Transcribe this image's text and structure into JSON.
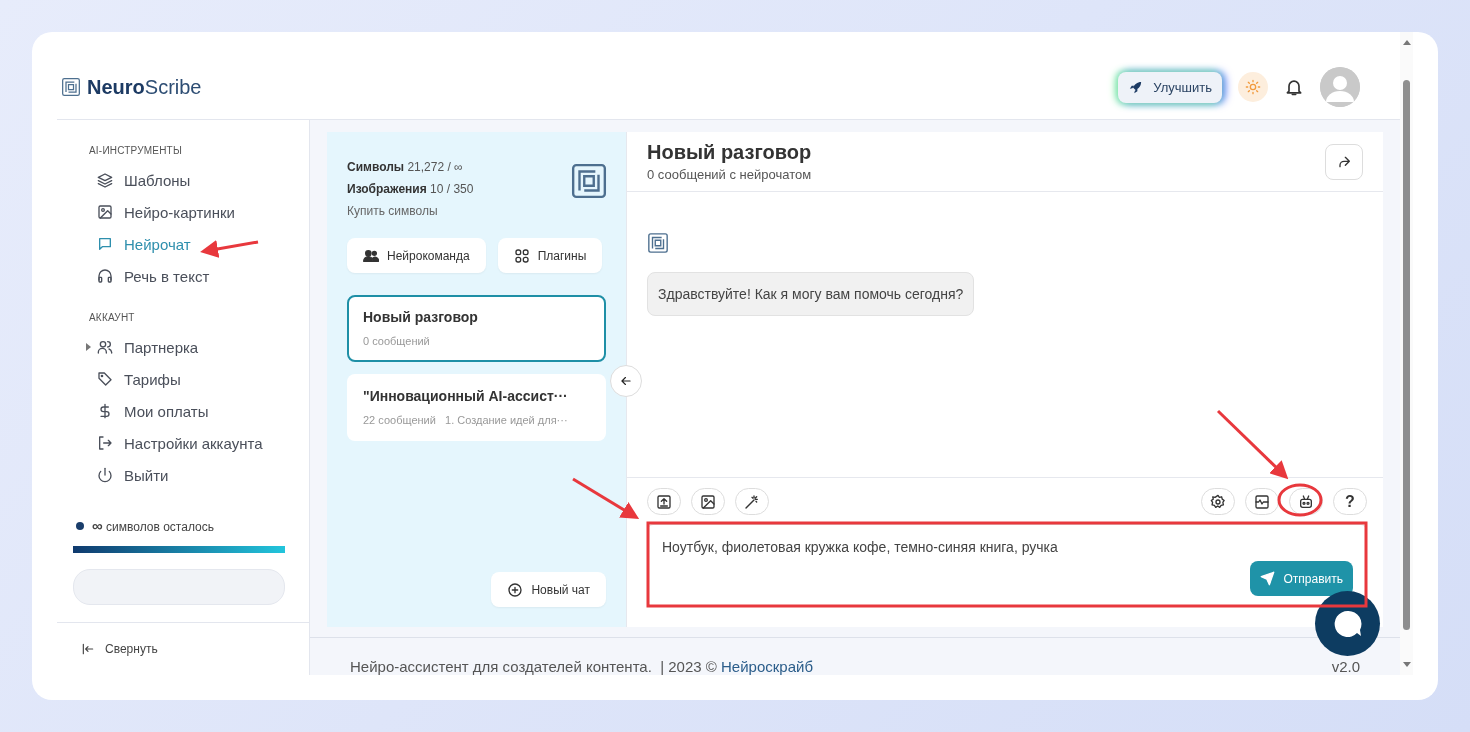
{
  "brand": {
    "name": "**Neuro**Scribe"
  },
  "header": {
    "upgrade_button": "Улучшить"
  },
  "sidebar": {
    "sections": [
      {
        "title": "AI-ИНСТРУМЕНТЫ",
        "items": [
          {
            "label": "Шаблоны",
            "kind": "layers",
            "selected": false,
            "expandable": false
          },
          {
            "label": "Нейро-картинки",
            "kind": "image",
            "selected": false,
            "expandable": false
          },
          {
            "label": "Нейрочат",
            "kind": "chat",
            "selected": true,
            "expandable": false
          },
          {
            "label": "Речь в текст",
            "kind": "headphones",
            "selected": false,
            "expandable": false
          }
        ]
      },
      {
        "title": "АККАУНТ",
        "items": [
          {
            "label": "Партнерка",
            "kind": "users",
            "selected": false,
            "expandable": true
          },
          {
            "label": "Тарифы",
            "kind": "tag",
            "selected": false,
            "expandable": false
          },
          {
            "label": "Мои оплаты",
            "kind": "dollar",
            "selected": false,
            "expandable": false
          },
          {
            "label": "Настройки аккаунта",
            "kind": "login",
            "selected": false,
            "expandable": false
          },
          {
            "label": "Выйти",
            "kind": "power",
            "selected": false,
            "expandable": false
          }
        ]
      }
    ],
    "balance": {
      "amount": "∞",
      "label": "символов осталось",
      "level": 1
    },
    "collapse": "Свернуть"
  },
  "chat_list": {
    "stats": [
      {
        "label": "Символы",
        "value": "21,272 / ∞"
      },
      {
        "label": "Изображения",
        "value": "10 / 350"
      }
    ],
    "buy_link": "Купить символы",
    "buttons": [
      {
        "label": "Нейрокоманда",
        "kind": "team"
      },
      {
        "label": "Плагины",
        "kind": "grid"
      }
    ],
    "conversations": [
      {
        "title": "Новый разговор",
        "meta": "0 сообщений",
        "selected": true
      },
      {
        "title": "\"Инновационный AI-ассист···",
        "meta": "22 сообщений   1. Создание идей для···",
        "selected": false
      }
    ],
    "new_chat": "Новый чат"
  },
  "chat": {
    "title": "Новый разговор",
    "subtitle": "0 сообщений с нейрочатом",
    "messages": [
      {
        "text": "Здравствуйте! Как я могу вам помочь сегодня?"
      }
    ],
    "tools_left": [
      {
        "kind": "upload"
      },
      {
        "kind": "image"
      },
      {
        "kind": "wand"
      }
    ],
    "tools_right": [
      {
        "kind": "gear"
      },
      {
        "kind": "panel"
      },
      {
        "kind": "robot"
      },
      {
        "kind": "text",
        "label": "?"
      }
    ],
    "input": {
      "value": "Ноутбук, фиолетовая кружка кофе, темно-синяя книга, ручка"
    },
    "send_button": "Отправить"
  },
  "footer": {
    "text": "Нейро-ассистент для создателей контента.  | 2023 © ",
    "link": "Нейроскрайб",
    "version": "v2.0"
  }
}
